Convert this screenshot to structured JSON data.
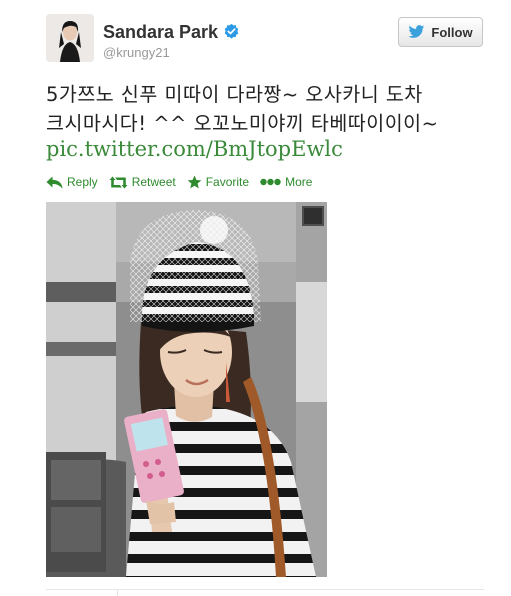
{
  "user": {
    "name": "Sandara Park",
    "handle": "@krungy21"
  },
  "follow_button": {
    "label": "Follow"
  },
  "tweet": {
    "lines": [
      "5가쯔노 신푸 미따이 다라짱~ 오사카니 도차",
      "크시마시다! ^^ 오꼬노미야끼 타베따이이이~"
    ],
    "link": "pic.twitter.com/BmJtopEwlc"
  },
  "actions": {
    "reply": "Reply",
    "retweet": "Retweet",
    "favorite": "Favorite",
    "more": "More"
  },
  "colors": {
    "link_green": "#3a8a3a",
    "verified_blue": "#2b9be8",
    "twitter_bird_blue": "#3aa1dc"
  },
  "icons": [
    "verified-badge-icon",
    "twitter-bird-icon",
    "reply-arrow-icon",
    "retweet-icon",
    "star-icon",
    "more-dots-icon"
  ]
}
